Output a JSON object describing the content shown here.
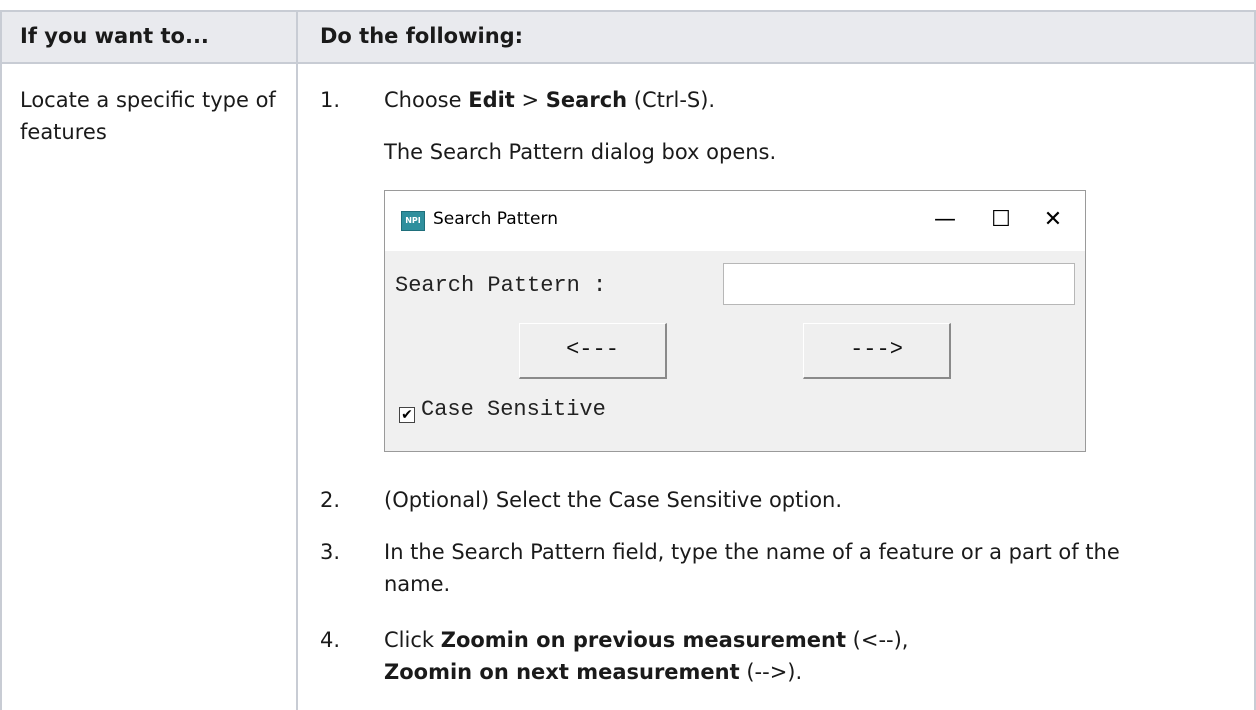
{
  "header": {
    "col1": "If you want to...",
    "col2": "Do the following:"
  },
  "row": {
    "left": "Locate a specific type of features"
  },
  "steps": [
    {
      "num": "1."
    },
    {
      "num": "2.",
      "text": "(Optional) Select the Case Sensitive option."
    },
    {
      "num": "3.",
      "text": "In the Search Pattern field, type the name of a feature or a part of the name."
    },
    {
      "num": "4."
    }
  ],
  "step1": {
    "prefix": "Choose ",
    "edit": "Edit",
    "sep": " > ",
    "search": "Search",
    "suffix": " (Ctrl-S).",
    "note": "The Search Pattern dialog box opens."
  },
  "step4": {
    "click": "Click ",
    "prev": "Zoomin on previous measurement",
    "prev_suffix": " (<--),",
    "next": "Zoomin on next measurement",
    "next_suffix": " (-->)."
  },
  "dialog": {
    "icon_text": "NPI",
    "title": "Search Pattern",
    "minimize": "—",
    "maximize": "☐",
    "close": "✕",
    "label": "Search Pattern :",
    "input_value": "",
    "prev_button": "<---",
    "next_button": "--->",
    "checkbox_checked": true,
    "checkbox_mark": "✔",
    "checkbox_label": "Case Sensitive"
  }
}
